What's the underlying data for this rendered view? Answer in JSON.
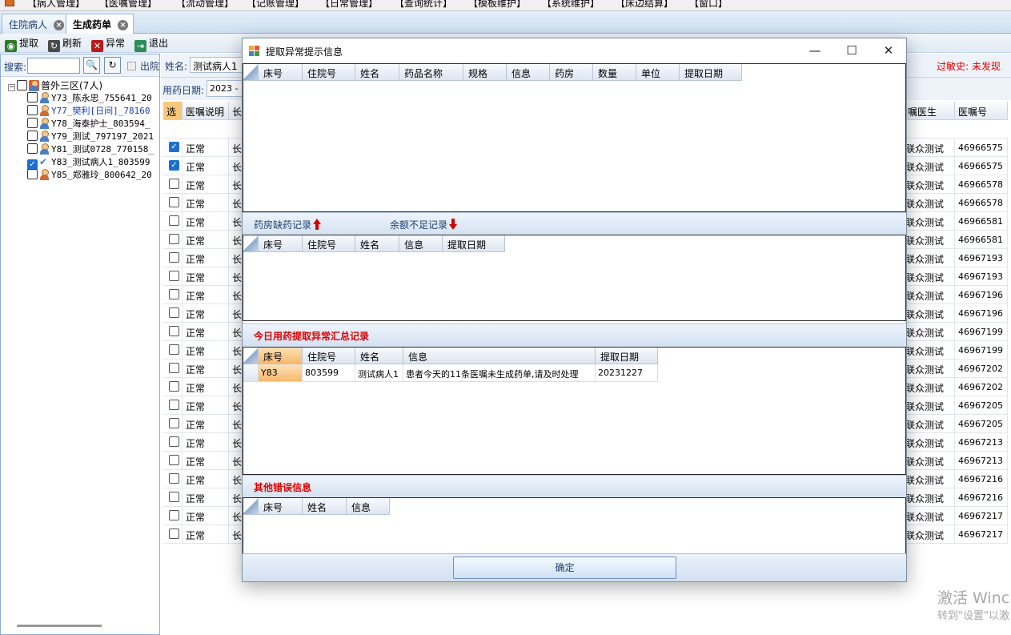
{
  "menu": [
    "【病人管理】",
    "【医嘱管理】",
    "【流动管理】",
    "【记账管理】",
    "【日常管理】",
    "【查询统计】",
    "【模板维护】",
    "【系统维护】",
    "【床边结算】",
    "【窗口】"
  ],
  "tabs": [
    {
      "label": "住院病人",
      "active": false
    },
    {
      "label": "生成药单",
      "active": true
    }
  ],
  "toolbar": {
    "fetch": "提取",
    "refresh": "刷新",
    "abnormal": "异常",
    "exit": "退出"
  },
  "left": {
    "search_label": "搜索:",
    "search_value": "",
    "discharged_label": "出院",
    "ward": "普外三区(7人)",
    "patients": [
      {
        "label": "Y73_陈永忠_755641_20",
        "gender": "m",
        "checked": false,
        "blue": false
      },
      {
        "label": "Y77_樊利[日间]_78160",
        "gender": "f",
        "checked": false,
        "blue": true
      },
      {
        "label": "Y78_海泰护士_803594_",
        "gender": "m",
        "checked": false,
        "blue": false
      },
      {
        "label": "Y79_测试_797197_2021",
        "gender": "m",
        "checked": false,
        "blue": false
      },
      {
        "label": "Y81_测试0728_770158_",
        "gender": "m",
        "checked": false,
        "blue": false
      },
      {
        "label": "Y83_测试病人1_803599",
        "gender": "check",
        "checked": true,
        "blue": false
      },
      {
        "label": "Y85_郑雅玲_800642_20",
        "gender": "f",
        "checked": false,
        "blue": false
      }
    ]
  },
  "main": {
    "name_label": "姓名:",
    "name_value": "测试病人1",
    "allergy": "过敏史: 未发现",
    "date_label": "用药日期:",
    "date_value": "2023 -",
    "headers": {
      "sel": "选",
      "note": "医嘱说明",
      "long": "长",
      "doctor": "嘱医生",
      "order_no": "医嘱号"
    },
    "rows": [
      {
        "checked": true,
        "status": "正常",
        "t": "长",
        "doctor": "联众测试",
        "order": "46966575"
      },
      {
        "checked": true,
        "status": "正常",
        "t": "长",
        "doctor": "联众测试",
        "order": "46966575"
      },
      {
        "checked": false,
        "status": "正常",
        "t": "长",
        "doctor": "联众测试",
        "order": "46966578"
      },
      {
        "checked": false,
        "status": "正常",
        "t": "长",
        "doctor": "联众测试",
        "order": "46966578"
      },
      {
        "checked": false,
        "status": "正常",
        "t": "长",
        "doctor": "联众测试",
        "order": "46966581"
      },
      {
        "checked": false,
        "status": "正常",
        "t": "长",
        "doctor": "联众测试",
        "order": "46966581"
      },
      {
        "checked": false,
        "status": "正常",
        "t": "长",
        "doctor": "联众测试",
        "order": "46967193"
      },
      {
        "checked": false,
        "status": "正常",
        "t": "长",
        "doctor": "联众测试",
        "order": "46967193"
      },
      {
        "checked": false,
        "status": "正常",
        "t": "长",
        "doctor": "联众测试",
        "order": "46967196"
      },
      {
        "checked": false,
        "status": "正常",
        "t": "长",
        "doctor": "联众测试",
        "order": "46967196"
      },
      {
        "checked": false,
        "status": "正常",
        "t": "长",
        "doctor": "联众测试",
        "order": "46967199"
      },
      {
        "checked": false,
        "status": "正常",
        "t": "长",
        "doctor": "联众测试",
        "order": "46967199"
      },
      {
        "checked": false,
        "status": "正常",
        "t": "长",
        "doctor": "联众测试",
        "order": "46967202"
      },
      {
        "checked": false,
        "status": "正常",
        "t": "长",
        "doctor": "联众测试",
        "order": "46967202"
      },
      {
        "checked": false,
        "status": "正常",
        "t": "长",
        "doctor": "联众测试",
        "order": "46967205"
      },
      {
        "checked": false,
        "status": "正常",
        "t": "长",
        "doctor": "联众测试",
        "order": "46967205"
      },
      {
        "checked": false,
        "status": "正常",
        "t": "长",
        "doctor": "联众测试",
        "order": "46967213"
      },
      {
        "checked": false,
        "status": "正常",
        "t": "长",
        "doctor": "联众测试",
        "order": "46967213"
      },
      {
        "checked": false,
        "status": "正常",
        "t": "长",
        "doctor": "联众测试",
        "order": "46967216"
      },
      {
        "checked": false,
        "status": "正常",
        "t": "长",
        "doctor": "联众测试",
        "order": "46967216"
      },
      {
        "checked": false,
        "status": "正常",
        "t": "长",
        "doctor": "联众测试",
        "order": "46967217"
      },
      {
        "checked": false,
        "status": "正常",
        "t": "长",
        "doctor": "联众测试",
        "order": "46967217"
      }
    ]
  },
  "dialog": {
    "title": "提取异常提示信息",
    "grid1_cols": [
      "床号",
      "住院号",
      "姓名",
      "药品名称",
      "规格",
      "信息",
      "药房",
      "数量",
      "单位",
      "提取日期"
    ],
    "band2": {
      "left": "药房缺药记录",
      "right": "余额不足记录"
    },
    "grid2_cols": [
      "床号",
      "住院号",
      "姓名",
      "信息",
      "提取日期"
    ],
    "band3": "今日用药提取异常汇总记录",
    "grid3_cols": [
      "床号",
      "住院号",
      "姓名",
      "信息",
      "提取日期"
    ],
    "grid3_rows": [
      {
        "bed": "Y83",
        "inpatient_no": "803599",
        "name": "测试病人1",
        "info": "患者今天的11条医嘱未生成药单,请及时处理",
        "date": "20231227"
      }
    ],
    "band4": "其他错误信息",
    "grid4_cols": [
      "床号",
      "姓名",
      "信息"
    ],
    "ok": "确定"
  },
  "watermark": {
    "line1": "激活 Winc",
    "line2": "转到\"设置\"以激"
  }
}
